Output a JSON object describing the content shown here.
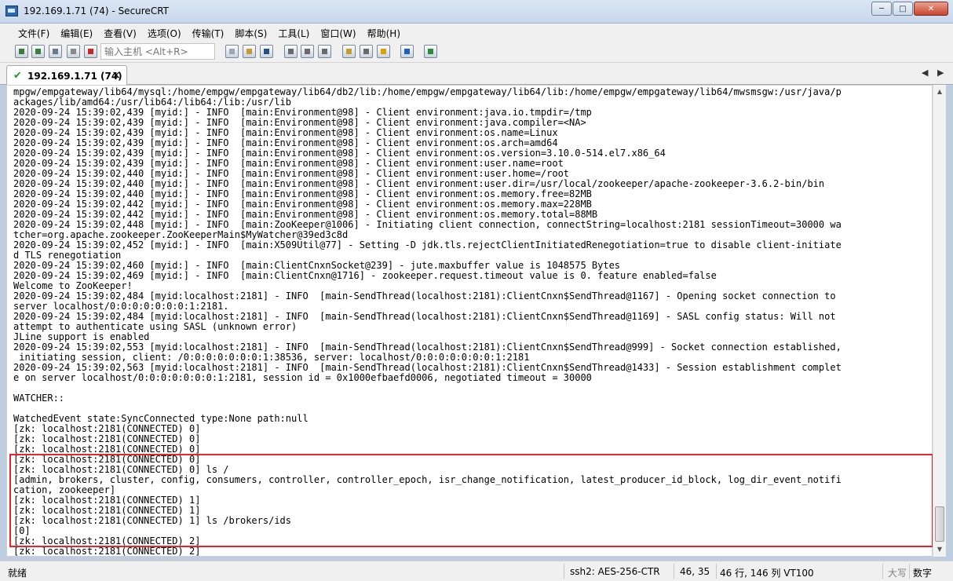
{
  "window": {
    "title": "192.169.1.71 (74) - SecureCRT"
  },
  "menu": [
    "文件(F)",
    "编辑(E)",
    "查看(V)",
    "选项(O)",
    "传输(T)",
    "脚本(S)",
    "工具(L)",
    "窗口(W)",
    "帮助(H)"
  ],
  "toolbar": {
    "host_placeholder": "输入主机 <Alt+R>"
  },
  "tab": {
    "label": "192.169.1.71 (74)"
  },
  "terminal": {
    "lines": [
      "mpgw/empgateway/lib64/mysql:/home/empgw/empgateway/lib64/db2/lib:/home/empgw/empgateway/lib64/lib:/home/empgw/empgateway/lib64/mwsmsgw:/usr/java/p",
      "ackages/lib/amd64:/usr/lib64:/lib64:/lib:/usr/lib",
      "2020-09-24 15:39:02,439 [myid:] - INFO  [main:Environment@98] - Client environment:java.io.tmpdir=/tmp",
      "2020-09-24 15:39:02,439 [myid:] - INFO  [main:Environment@98] - Client environment:java.compiler=<NA>",
      "2020-09-24 15:39:02,439 [myid:] - INFO  [main:Environment@98] - Client environment:os.name=Linux",
      "2020-09-24 15:39:02,439 [myid:] - INFO  [main:Environment@98] - Client environment:os.arch=amd64",
      "2020-09-24 15:39:02,439 [myid:] - INFO  [main:Environment@98] - Client environment:os.version=3.10.0-514.el7.x86_64",
      "2020-09-24 15:39:02,439 [myid:] - INFO  [main:Environment@98] - Client environment:user.name=root",
      "2020-09-24 15:39:02,440 [myid:] - INFO  [main:Environment@98] - Client environment:user.home=/root",
      "2020-09-24 15:39:02,440 [myid:] - INFO  [main:Environment@98] - Client environment:user.dir=/usr/local/zookeeper/apache-zookeeper-3.6.2-bin/bin",
      "2020-09-24 15:39:02,440 [myid:] - INFO  [main:Environment@98] - Client environment:os.memory.free=82MB",
      "2020-09-24 15:39:02,442 [myid:] - INFO  [main:Environment@98] - Client environment:os.memory.max=228MB",
      "2020-09-24 15:39:02,442 [myid:] - INFO  [main:Environment@98] - Client environment:os.memory.total=88MB",
      "2020-09-24 15:39:02,448 [myid:] - INFO  [main:ZooKeeper@1006] - Initiating client connection, connectString=localhost:2181 sessionTimeout=30000 wa",
      "tcher=org.apache.zookeeper.ZooKeeperMain$MyWatcher@39ed3c8d",
      "2020-09-24 15:39:02,452 [myid:] - INFO  [main:X509Util@77] - Setting -D jdk.tls.rejectClientInitiatedRenegotiation=true to disable client-initiate",
      "d TLS renegotiation",
      "2020-09-24 15:39:02,460 [myid:] - INFO  [main:ClientCnxnSocket@239] - jute.maxbuffer value is 1048575 Bytes",
      "2020-09-24 15:39:02,469 [myid:] - INFO  [main:ClientCnxn@1716] - zookeeper.request.timeout value is 0. feature enabled=false",
      "Welcome to ZooKeeper!",
      "2020-09-24 15:39:02,484 [myid:localhost:2181] - INFO  [main-SendThread(localhost:2181):ClientCnxn$SendThread@1167] - Opening socket connection to",
      "server localhost/0:0:0:0:0:0:0:1:2181.",
      "2020-09-24 15:39:02,484 [myid:localhost:2181] - INFO  [main-SendThread(localhost:2181):ClientCnxn$SendThread@1169] - SASL config status: Will not",
      "attempt to authenticate using SASL (unknown error)",
      "JLine support is enabled",
      "2020-09-24 15:39:02,553 [myid:localhost:2181] - INFO  [main-SendThread(localhost:2181):ClientCnxn$SendThread@999] - Socket connection established,",
      " initiating session, client: /0:0:0:0:0:0:0:1:38536, server: localhost/0:0:0:0:0:0:0:1:2181",
      "2020-09-24 15:39:02,563 [myid:localhost:2181] - INFO  [main-SendThread(localhost:2181):ClientCnxn$SendThread@1433] - Session establishment complet",
      "e on server localhost/0:0:0:0:0:0:0:1:2181, session id = 0x1000efbaefd0006, negotiated timeout = 30000",
      "",
      "WATCHER::",
      "",
      "WatchedEvent state:SyncConnected type:None path:null",
      "[zk: localhost:2181(CONNECTED) 0]",
      "[zk: localhost:2181(CONNECTED) 0]",
      "[zk: localhost:2181(CONNECTED) 0]",
      "[zk: localhost:2181(CONNECTED) 0]",
      "[zk: localhost:2181(CONNECTED) 0] ls /",
      "[admin, brokers, cluster, config, consumers, controller, controller_epoch, isr_change_notification, latest_producer_id_block, log_dir_event_notifi",
      "cation, zookeeper]",
      "[zk: localhost:2181(CONNECTED) 1]",
      "[zk: localhost:2181(CONNECTED) 1]",
      "[zk: localhost:2181(CONNECTED) 1] ls /brokers/ids",
      "[0]",
      "[zk: localhost:2181(CONNECTED) 2]",
      "[zk: localhost:2181(CONNECTED) 2]"
    ]
  },
  "status": {
    "ready": "就绪",
    "protocol": "ssh2: AES-256-CTR",
    "cursor": "46,  35",
    "size": "46 行, 146 列 VT100",
    "caps": "大写",
    "num": "数字"
  },
  "colors": {
    "highlight_border": "#e8262a",
    "title_gradient": "#c7d7ec"
  }
}
